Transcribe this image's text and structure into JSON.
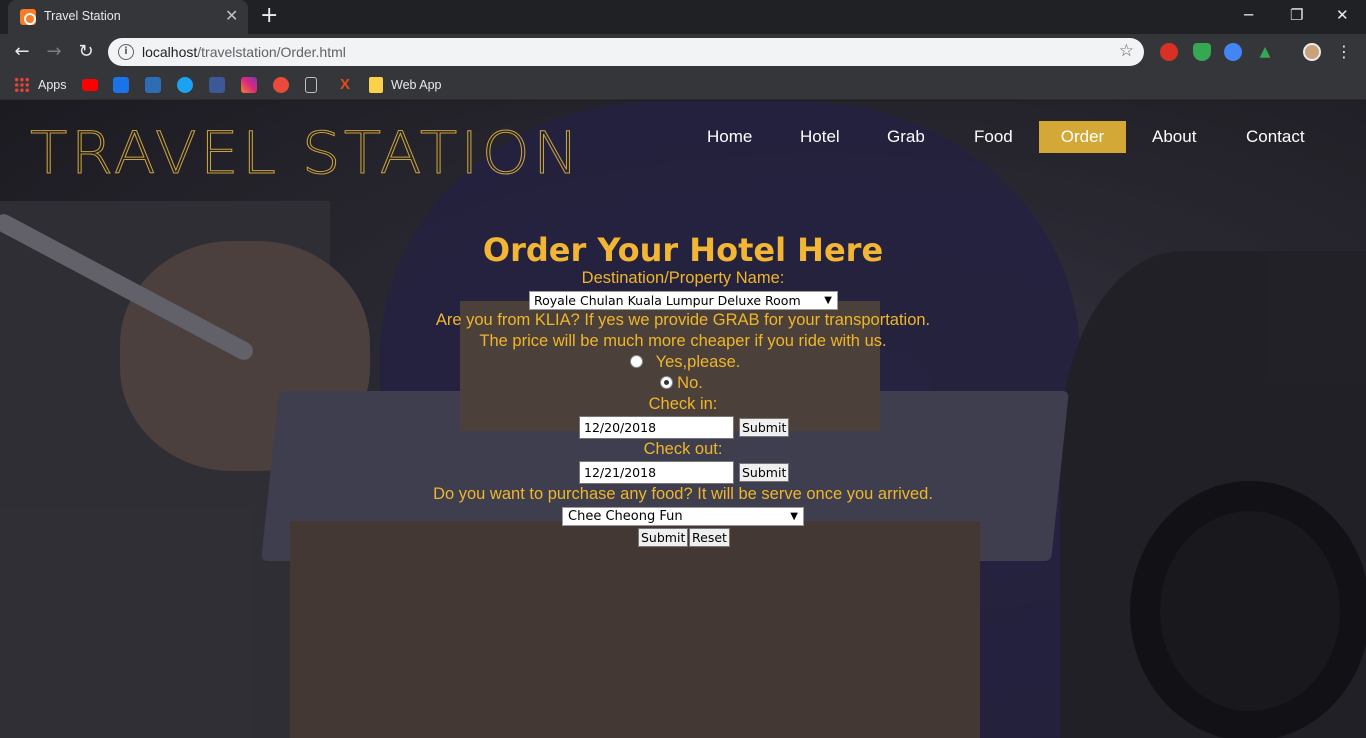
{
  "browser": {
    "tab_title": "Travel Station",
    "url_host": "localhost",
    "url_path": "/travelstation/Order.html",
    "bookmarks": [
      {
        "label": "Apps",
        "icon": "apps-grid-icon"
      },
      {
        "label": "",
        "icon": "youtube-icon",
        "color": "#ff0000"
      },
      {
        "label": "",
        "icon": "tag-icon",
        "color": "#1a73e8"
      },
      {
        "label": "",
        "icon": "playstation-icon",
        "color": "#2e6db4"
      },
      {
        "label": "",
        "icon": "twitter-icon",
        "color": "#1da1f2"
      },
      {
        "label": "",
        "icon": "facebook-icon",
        "color": "#3b5998"
      },
      {
        "label": "",
        "icon": "instagram-icon",
        "color": "#e1306c"
      },
      {
        "label": "",
        "icon": "play-icon",
        "color": "#e94a3b"
      },
      {
        "label": "",
        "icon": "page-icon",
        "color": "#bdc1c6"
      },
      {
        "label": "",
        "icon": "x-icon",
        "color": "#e64a19"
      },
      {
        "label": "Web App",
        "icon": "folder-icon",
        "color": "#f9d24a"
      }
    ]
  },
  "site": {
    "logo": "TRAVEL STATION",
    "nav": [
      "Home",
      "Hotel",
      "Grab",
      "Food",
      "Order",
      "About",
      "Contact"
    ],
    "active_nav": "Order",
    "accent": "#d4a836"
  },
  "form": {
    "title": "Order Your Hotel Here",
    "destination_label": "Destination/Property Name:",
    "destination_value": "Royale Chulan Kuala Lumpur Deluxe Room",
    "klia_line1": "Are you from KLIA? If yes we provide GRAB for your transportation.",
    "klia_line2": "The price will be much more cheaper if you ride with us.",
    "radio_yes": "Yes,please.",
    "radio_no": "No.",
    "radio_selected": "No.",
    "checkin_label": "Check in:",
    "checkin_value": "12/20/2018",
    "checkout_label": "Check out:",
    "checkout_value": "12/21/2018",
    "submit_label": "Submit",
    "food_question": "Do you want to purchase any food? It will be serve once you arrived.",
    "food_value": "Chee Cheong Fun",
    "reset_label": "Reset"
  }
}
